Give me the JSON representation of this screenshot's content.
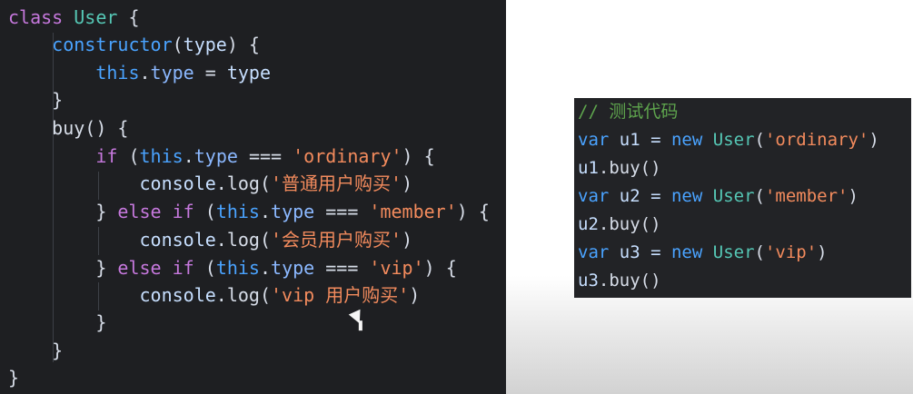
{
  "colors": {
    "background": "#ffffff",
    "editor_background": "#1e1f22",
    "test_editor_background": "#222326",
    "keyword_purple": "#c678dd",
    "keyword_blue": "#4aa3ff",
    "class_teal": "#55c7b5",
    "string_orange": "#f38b5d",
    "comment_green": "#5ea44d",
    "text": "#d7dde8"
  },
  "main_code": {
    "lines": [
      [
        {
          "t": "class",
          "c": "kw"
        },
        {
          "t": " ",
          "c": "op"
        },
        {
          "t": "User",
          "c": "cls"
        },
        {
          "t": " {",
          "c": "op"
        }
      ],
      [
        {
          "t": "    constructor",
          "c": "kw2"
        },
        {
          "t": "(",
          "c": "op"
        },
        {
          "t": "type",
          "c": "var"
        },
        {
          "t": ") {",
          "c": "op"
        }
      ],
      [
        {
          "t": "        this",
          "c": "kw2"
        },
        {
          "t": ".",
          "c": "op"
        },
        {
          "t": "type",
          "c": "prop"
        },
        {
          "t": " = ",
          "c": "op"
        },
        {
          "t": "type",
          "c": "var"
        }
      ],
      [
        {
          "t": "    }",
          "c": "op"
        }
      ],
      [
        {
          "t": "    buy",
          "c": "fn"
        },
        {
          "t": "() {",
          "c": "op"
        }
      ],
      [
        {
          "t": "        if",
          "c": "kw"
        },
        {
          "t": " (",
          "c": "op"
        },
        {
          "t": "this",
          "c": "kw2"
        },
        {
          "t": ".",
          "c": "op"
        },
        {
          "t": "type",
          "c": "prop"
        },
        {
          "t": " === ",
          "c": "op"
        },
        {
          "t": "'ordinary'",
          "c": "str"
        },
        {
          "t": ") {",
          "c": "op"
        }
      ],
      [
        {
          "t": "            console",
          "c": "var"
        },
        {
          "t": ".",
          "c": "op"
        },
        {
          "t": "log",
          "c": "fn"
        },
        {
          "t": "(",
          "c": "op"
        },
        {
          "t": "'普通用户购买'",
          "c": "str"
        },
        {
          "t": ")",
          "c": "op"
        }
      ],
      [
        {
          "t": "        } ",
          "c": "op"
        },
        {
          "t": "else if",
          "c": "kw"
        },
        {
          "t": " (",
          "c": "op"
        },
        {
          "t": "this",
          "c": "kw2"
        },
        {
          "t": ".",
          "c": "op"
        },
        {
          "t": "type",
          "c": "prop"
        },
        {
          "t": " === ",
          "c": "op"
        },
        {
          "t": "'member'",
          "c": "str"
        },
        {
          "t": ") {",
          "c": "op"
        }
      ],
      [
        {
          "t": "            console",
          "c": "var"
        },
        {
          "t": ".",
          "c": "op"
        },
        {
          "t": "log",
          "c": "fn"
        },
        {
          "t": "(",
          "c": "op"
        },
        {
          "t": "'会员用户购买'",
          "c": "str"
        },
        {
          "t": ")",
          "c": "op"
        }
      ],
      [
        {
          "t": "        } ",
          "c": "op"
        },
        {
          "t": "else if",
          "c": "kw"
        },
        {
          "t": " (",
          "c": "op"
        },
        {
          "t": "this",
          "c": "kw2"
        },
        {
          "t": ".",
          "c": "op"
        },
        {
          "t": "type",
          "c": "prop"
        },
        {
          "t": " === ",
          "c": "op"
        },
        {
          "t": "'vip'",
          "c": "str"
        },
        {
          "t": ") {",
          "c": "op"
        }
      ],
      [
        {
          "t": "            console",
          "c": "var"
        },
        {
          "t": ".",
          "c": "op"
        },
        {
          "t": "log",
          "c": "fn"
        },
        {
          "t": "(",
          "c": "op"
        },
        {
          "t": "'vip 用户购买'",
          "c": "str"
        },
        {
          "t": ")",
          "c": "op"
        }
      ],
      [
        {
          "t": "        }",
          "c": "op"
        }
      ],
      [
        {
          "t": "    }",
          "c": "op"
        }
      ],
      [
        {
          "t": "}",
          "c": "op"
        }
      ]
    ]
  },
  "test_code": {
    "lines": [
      [
        {
          "t": "// 测试代码",
          "c": "comment"
        }
      ],
      [
        {
          "t": "var",
          "c": "kw2"
        },
        {
          "t": " u1 = ",
          "c": "var"
        },
        {
          "t": "new",
          "c": "kw2"
        },
        {
          "t": " ",
          "c": "op"
        },
        {
          "t": "User",
          "c": "cls"
        },
        {
          "t": "(",
          "c": "op"
        },
        {
          "t": "'ordinary'",
          "c": "str"
        },
        {
          "t": ")",
          "c": "op"
        }
      ],
      [
        {
          "t": "u1",
          "c": "var"
        },
        {
          "t": ".",
          "c": "op"
        },
        {
          "t": "buy",
          "c": "fn"
        },
        {
          "t": "()",
          "c": "op"
        }
      ],
      [
        {
          "t": "var",
          "c": "kw2"
        },
        {
          "t": " u2 = ",
          "c": "var"
        },
        {
          "t": "new",
          "c": "kw2"
        },
        {
          "t": " ",
          "c": "op"
        },
        {
          "t": "User",
          "c": "cls"
        },
        {
          "t": "(",
          "c": "op"
        },
        {
          "t": "'member'",
          "c": "str"
        },
        {
          "t": ")",
          "c": "op"
        }
      ],
      [
        {
          "t": "u2",
          "c": "var"
        },
        {
          "t": ".",
          "c": "op"
        },
        {
          "t": "buy",
          "c": "fn"
        },
        {
          "t": "()",
          "c": "op"
        }
      ],
      [
        {
          "t": "var",
          "c": "kw2"
        },
        {
          "t": " u3 = ",
          "c": "var"
        },
        {
          "t": "new",
          "c": "kw2"
        },
        {
          "t": " ",
          "c": "op"
        },
        {
          "t": "User",
          "c": "cls"
        },
        {
          "t": "(",
          "c": "op"
        },
        {
          "t": "'vip'",
          "c": "str"
        },
        {
          "t": ")",
          "c": "op"
        }
      ],
      [
        {
          "t": "u3",
          "c": "var"
        },
        {
          "t": ".",
          "c": "op"
        },
        {
          "t": "buy",
          "c": "fn"
        },
        {
          "t": "()",
          "c": "op"
        }
      ]
    ]
  }
}
